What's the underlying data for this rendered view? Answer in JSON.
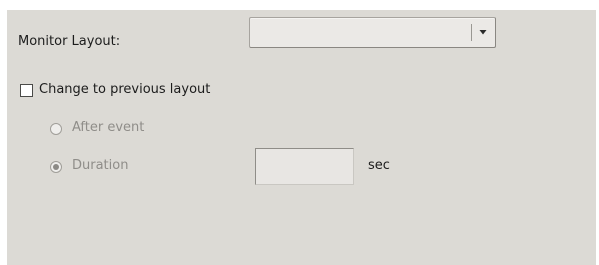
{
  "monitor_layout": {
    "label": "Monitor Layout:",
    "selected_value": "",
    "dropdown_icon": "chevron-down-icon"
  },
  "change_layout": {
    "checkbox_label": "Change to previous layout",
    "checked": false
  },
  "options": {
    "after_event_label": "After event",
    "after_event_selected": false,
    "duration_label": "Duration",
    "duration_selected": true,
    "duration_value": "",
    "duration_unit": "sec"
  },
  "colors": {
    "panel_background": "#dcdad5",
    "disabled_text": "#8f8d89"
  }
}
